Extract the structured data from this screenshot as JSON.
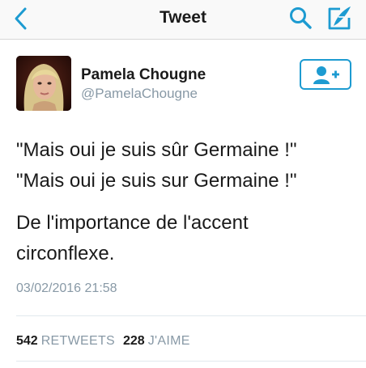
{
  "nav": {
    "title": "Tweet",
    "back_icon": "chevron-left-icon",
    "search_icon": "search-icon",
    "compose_icon": "compose-tweet-icon",
    "accent_color": "#1d9bd1"
  },
  "author": {
    "display_name": "Pamela Chougne",
    "handle": "@PamelaChougne",
    "follow_icon": "follow-user-icon"
  },
  "tweet": {
    "line_1": "\"Mais oui je suis sûr Germaine !\"",
    "line_2": "\"Mais oui je suis sur Germaine !\"",
    "line_3": "De l'importance de l'accent",
    "line_4": "circonflexe.",
    "timestamp": "03/02/2016 21:58"
  },
  "stats": {
    "retweets_count": "542",
    "retweets_label": "RETWEETS",
    "likes_count": "228",
    "likes_label": "J'AIME"
  }
}
